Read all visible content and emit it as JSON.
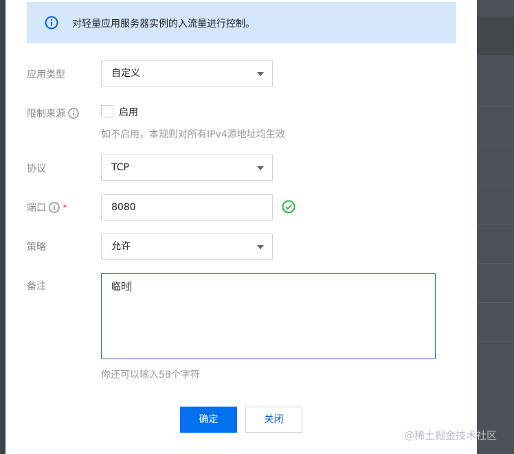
{
  "notice": {
    "text": "对轻量应用服务器实例的入流量进行控制。"
  },
  "form": {
    "app_type": {
      "label": "应用类型",
      "value": "自定义"
    },
    "source_limit": {
      "label": "限制来源",
      "checkbox_label": "启用",
      "hint": "如不启用，本规则对所有IPv4源地址均生效"
    },
    "protocol": {
      "label": "协议",
      "value": "TCP"
    },
    "port": {
      "label": "端口",
      "required_mark": "*",
      "value": "8080"
    },
    "policy": {
      "label": "策略",
      "value": "允许"
    },
    "remark": {
      "label": "备注",
      "value": "临时",
      "counter": "你还可以输入58个字符"
    }
  },
  "buttons": {
    "confirm": "确定",
    "close": "关闭"
  },
  "watermark": "@稀土掘金技术社区",
  "colors": {
    "primary": "#0070f0",
    "notice_bg": "#d5e7fd",
    "valid": "#2bb94a",
    "required": "#e54545"
  }
}
